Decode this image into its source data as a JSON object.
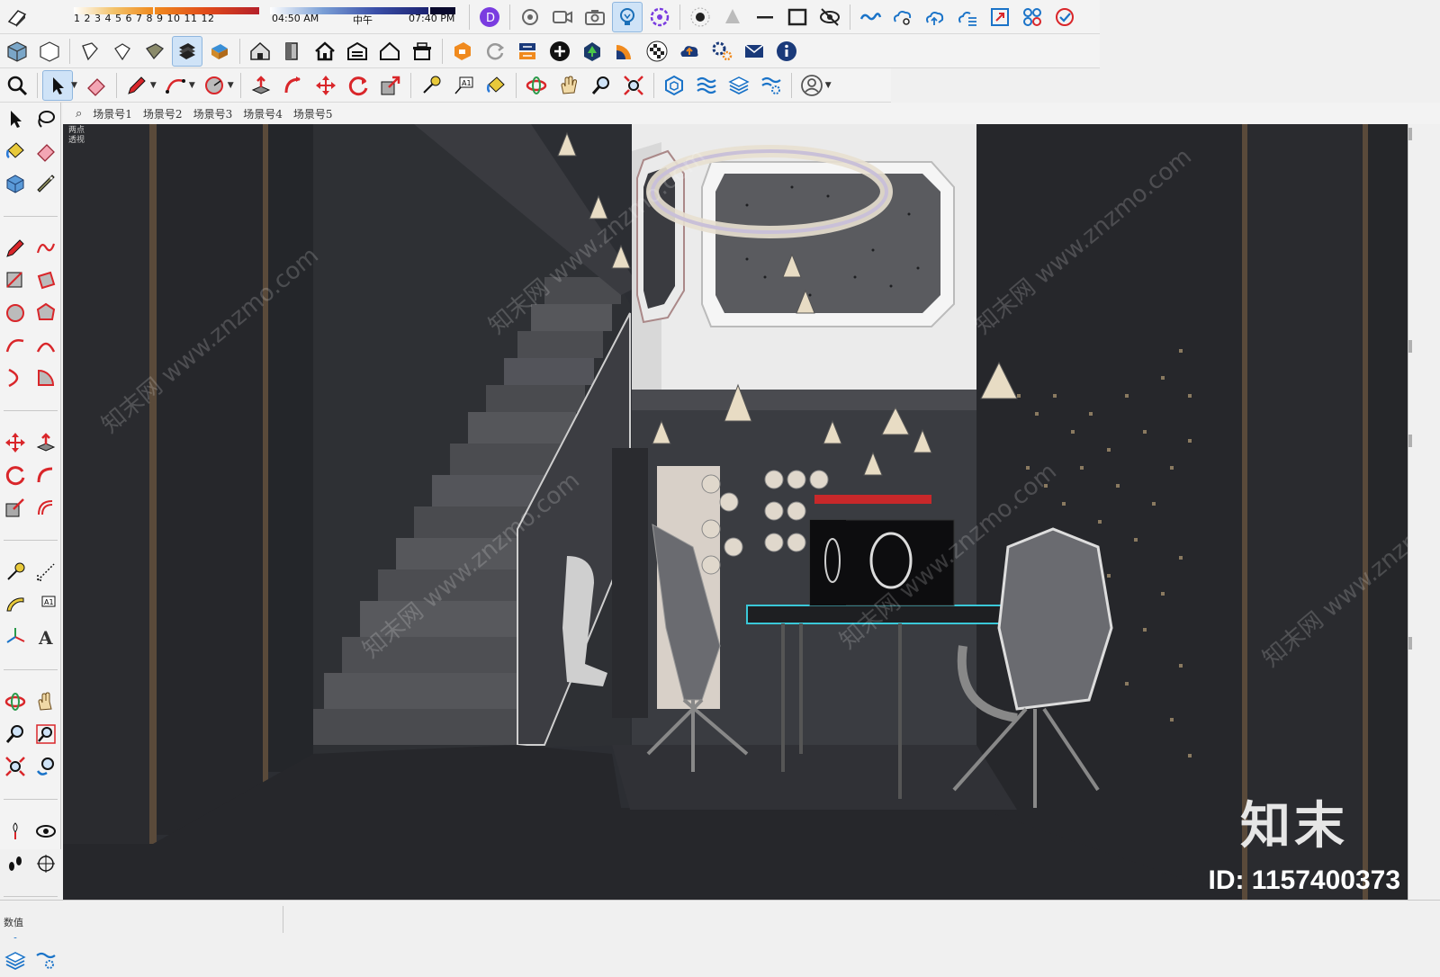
{
  "shadow_settings": {
    "month_numbers": "1 2 3 4 5 6 7 8 9 10 11 12",
    "time_start": "04:50 AM",
    "time_noon": "中午",
    "time_end": "07:40 PM"
  },
  "scene_tabs": [
    "场景号1",
    "场景号2",
    "场景号3",
    "场景号4",
    "场景号5"
  ],
  "camera_label": "两点透视",
  "watermark": {
    "site": "知末网 www.znzmo.com",
    "logo": "知末",
    "id": "ID: 1157400373"
  },
  "status_bar": {
    "text": "数值"
  },
  "colors": {
    "toolbar_bg": "#f3f3f3",
    "viewport_bg": "#2a2c30",
    "active_tool": "#cfe3f7",
    "accent_red": "#d9262a",
    "accent_blue": "#1a73c8"
  },
  "toolbars": {
    "row1": [
      "shadow-toggle-icon",
      "orbit-camera-icon",
      "camera-video-icon",
      "camera-photo-icon",
      "lightbulb-icon",
      "gear-flower-icon",
      "point-icon",
      "cone-icon",
      "line-icon",
      "rectangle-icon",
      "eye-hidden-icon",
      "cloud-link-icon",
      "cloud-search-icon",
      "cloud-upload-icon",
      "cloud-list-icon",
      "resize-icon",
      "components-icon",
      "check-cycle-icon"
    ],
    "row2": [
      "iso-view-icon",
      "top-view-icon",
      "front-view-icon",
      "right-view-icon",
      "back-view-icon",
      "left-view-icon",
      "bottom-view-icon",
      "house-3d-icon",
      "door-icon",
      "house-icon",
      "warehouse-icon",
      "house-outline-icon",
      "shop-icon",
      "extension-warehouse-icon",
      "refresh-icon",
      "transfer-icon",
      "add-circle-icon",
      "tree-upload-icon",
      "chart-fan-icon",
      "checker-sphere-icon",
      "cloud-upload-icon",
      "gears-icon",
      "mail-icon",
      "info-icon"
    ],
    "row3": [
      "zoom-icon",
      "select-icon",
      "eraser-icon",
      "pencil-icon",
      "arc-icon",
      "circle-icon",
      "push-pull-icon",
      "follow-me-icon",
      "move-icon",
      "rotate-icon",
      "scale-icon",
      "tape-measure-icon",
      "text-label-icon",
      "paint-bucket-icon",
      "orbit-icon",
      "pan-icon",
      "zoom-glass-icon",
      "zoom-extents-icon",
      "sandbox-icon",
      "layers-icon",
      "layers-stack-icon",
      "layers-settings-icon",
      "user-profile-icon"
    ]
  }
}
